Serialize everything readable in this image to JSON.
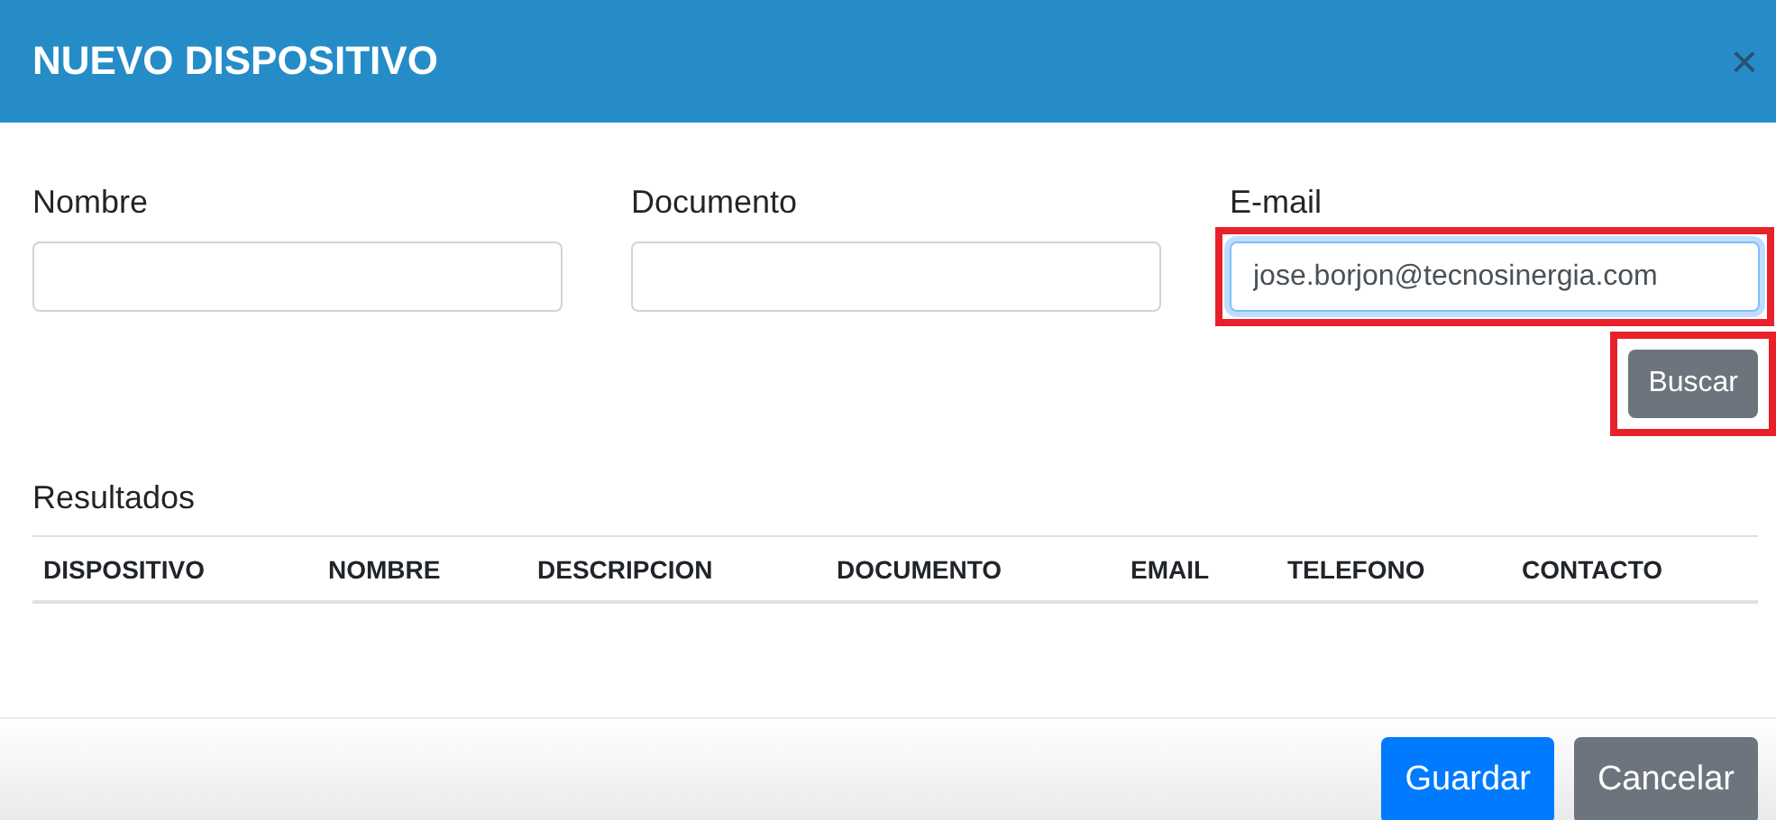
{
  "dialog": {
    "title": "NUEVO DISPOSITIVO",
    "close": "×"
  },
  "fields": [
    {
      "label": "Nombre",
      "focused": false,
      "highlighted": false
    },
    {
      "label": "Documento",
      "focused": false,
      "highlighted": false
    },
    {
      "label": "E-mail",
      "value": "jose.borjon@tecnosinergia.com",
      "focused": true,
      "highlighted": true
    }
  ],
  "search_button": {
    "label": "Buscar",
    "highlighted": true
  },
  "results": {
    "title": "Resultados",
    "columns": [
      "DISPOSITIVO",
      "NOMBRE",
      "DESCRIPCION",
      "DOCUMENTO",
      "EMAIL",
      "TELEFONO",
      "CONTACTO"
    ]
  },
  "footer": {
    "buttons": [
      {
        "label": "Guardar",
        "kind": "primary"
      },
      {
        "label": "Cancelar",
        "kind": "secondary"
      }
    ]
  }
}
